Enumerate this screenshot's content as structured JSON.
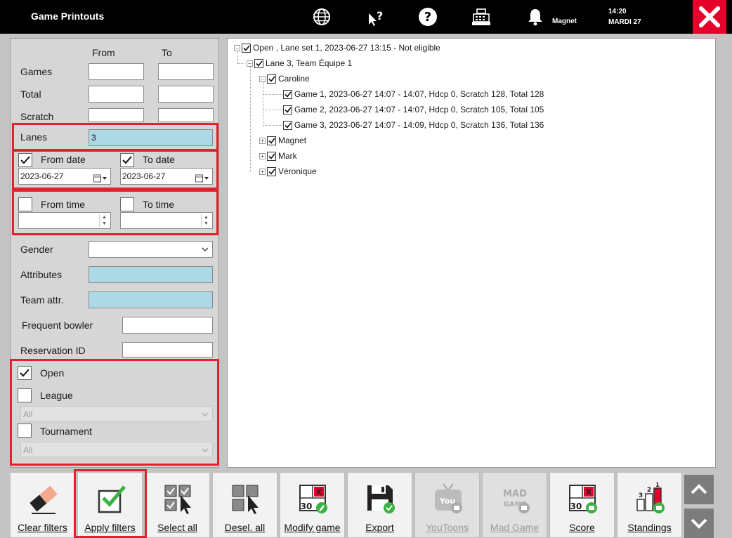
{
  "window": {
    "title": "Game Printouts"
  },
  "header": {
    "user": "Magnet",
    "time": "14:20",
    "day": "MARDI 27"
  },
  "filters": {
    "col_from": "From",
    "col_to": "To",
    "games_label": "Games",
    "total_label": "Total",
    "scratch_label": "Scratch",
    "lanes_label": "Lanes",
    "lanes_value": "3",
    "from_date_label": "From date",
    "from_date_value": "2023-06-27",
    "to_date_label": "To date",
    "to_date_value": "2023-06-27",
    "from_time_label": "From time",
    "to_time_label": "To time",
    "gender_label": "Gender",
    "attributes_label": "Attributes",
    "team_attr_label": "Team attr.",
    "frequent_bowler_label": "Frequent bowler",
    "reservation_id_label": "Reservation ID",
    "open_label": "Open",
    "league_label": "League",
    "league_select": "All",
    "tournament_label": "Tournament",
    "tournament_select": "All"
  },
  "tree": {
    "root": "Open , Lane set 1, 2023-06-27 13:15  - Not eligible",
    "lane": "Lane 3, Team Équipe 1",
    "players": [
      "Caroline",
      "Magnet",
      "Mark",
      "Véronique"
    ],
    "games": [
      "Game 1, 2023-06-27 14:07 - 14:07, Hdcp 0, Scratch 128, Total 128",
      "Game 2, 2023-06-27 14:07 - 14:07, Hdcp 0, Scratch 105, Total 105",
      "Game 3, 2023-06-27 14:07 - 14:09, Hdcp 0, Scratch 136, Total 136"
    ]
  },
  "toolbar": {
    "clear_filters": "Clear filters",
    "apply_filters": "Apply filters",
    "select_all": "Select all",
    "deselect_all": "Desel. all",
    "modify_game": "Modify game",
    "export": "Export",
    "youtoons": "YouToons",
    "mad_game": "Mad Game",
    "score": "Score",
    "standings": "Standings"
  },
  "colors": {
    "accent_red": "#e4002b",
    "field_blue": "#add8e6",
    "check_green": "#3cb043"
  },
  "icons": [
    "globe-icon",
    "help-cursor-icon",
    "question-icon",
    "cash-register-icon",
    "bell-icon",
    "close-icon",
    "chevron-up-icon",
    "chevron-down-icon"
  ]
}
